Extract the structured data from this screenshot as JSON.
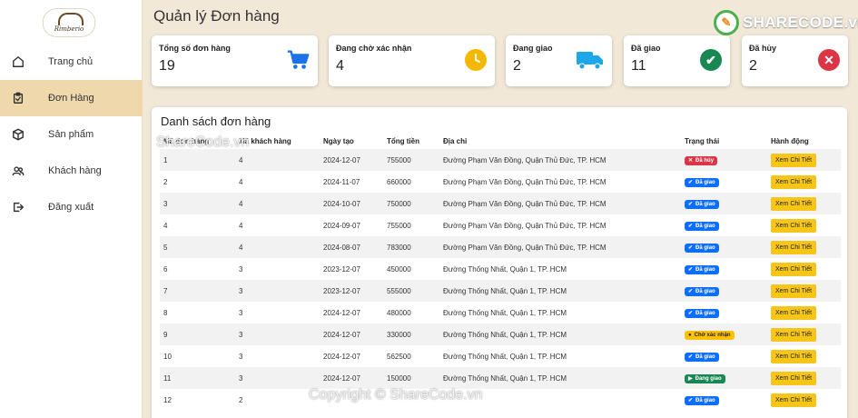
{
  "brand": {
    "logo_text": "Rimberio",
    "watermark_name": "SHARECODE",
    "watermark_tld": ".vn"
  },
  "watermark_top": "ShareCode.vn",
  "watermark_bottom": "Copyright © ShareCode.vn",
  "sidebar": {
    "items": [
      {
        "label": "Trang chủ",
        "icon": "home-icon"
      },
      {
        "label": "Đơn Hàng",
        "icon": "clipboard-icon",
        "active": true
      },
      {
        "label": "Sản phẩm",
        "icon": "box-icon"
      },
      {
        "label": "Khách hàng",
        "icon": "users-icon"
      },
      {
        "label": "Đăng xuất",
        "icon": "logout-icon"
      }
    ]
  },
  "page": {
    "title": "Quản lý Đơn hàng"
  },
  "stats": [
    {
      "label": "Tổng số đơn hàng",
      "value": "19",
      "icon": "cart-icon",
      "color": "#1a73e8"
    },
    {
      "label": "Đang chờ xác nhận",
      "value": "4",
      "icon": "clock-icon",
      "color": "#f5b800"
    },
    {
      "label": "Đang giao",
      "value": "2",
      "icon": "truck-icon",
      "color": "#1ea7e8"
    },
    {
      "label": "Đã giao",
      "value": "11",
      "icon": "check-circle-icon",
      "color": "#198754"
    },
    {
      "label": "Đã hủy",
      "value": "2",
      "icon": "x-circle-icon",
      "color": "#dc3545"
    }
  ],
  "orders": {
    "title": "Danh sách đơn hàng",
    "columns": [
      "Mã đơn hàng",
      "Mã khách hàng",
      "Ngày tạo",
      "Tổng tiền",
      "Địa chỉ",
      "Trạng thái",
      "Hành động"
    ],
    "action_label": "Xem Chi Tiết",
    "rows": [
      {
        "id": "1",
        "customer": "4",
        "date": "2024-12-07",
        "total": "755000",
        "address": "Đường Phạm Văn Đồng, Quận Thủ Đức, TP. HCM",
        "status": "Đã hủy",
        "status_type": "cancel"
      },
      {
        "id": "2",
        "customer": "4",
        "date": "2024-11-07",
        "total": "660000",
        "address": "Đường Phạm Văn Đồng, Quận Thủ Đức, TP. HCM",
        "status": "Đã giao",
        "status_type": "done"
      },
      {
        "id": "3",
        "customer": "4",
        "date": "2024-10-07",
        "total": "750000",
        "address": "Đường Phạm Văn Đồng, Quận Thủ Đức, TP. HCM",
        "status": "Đã giao",
        "status_type": "done"
      },
      {
        "id": "4",
        "customer": "4",
        "date": "2024-09-07",
        "total": "755000",
        "address": "Đường Phạm Văn Đồng, Quận Thủ Đức, TP. HCM",
        "status": "Đã giao",
        "status_type": "done"
      },
      {
        "id": "5",
        "customer": "4",
        "date": "2024-08-07",
        "total": "783000",
        "address": "Đường Phạm Văn Đồng, Quận Thủ Đức, TP. HCM",
        "status": "Đã giao",
        "status_type": "done"
      },
      {
        "id": "6",
        "customer": "3",
        "date": "2023-12-07",
        "total": "450000",
        "address": "Đường Thống Nhất, Quận 1, TP. HCM",
        "status": "Đã giao",
        "status_type": "done"
      },
      {
        "id": "7",
        "customer": "3",
        "date": "2023-12-07",
        "total": "555000",
        "address": "Đường Thống Nhất, Quận 1, TP. HCM",
        "status": "Đã giao",
        "status_type": "done"
      },
      {
        "id": "8",
        "customer": "3",
        "date": "2024-12-07",
        "total": "480000",
        "address": "Đường Thống Nhất, Quận 1, TP. HCM",
        "status": "Đã giao",
        "status_type": "done"
      },
      {
        "id": "9",
        "customer": "3",
        "date": "2024-12-07",
        "total": "330000",
        "address": "Đường Thống Nhất, Quận 1, TP. HCM",
        "status": "Chờ xác nhận",
        "status_type": "pending"
      },
      {
        "id": "10",
        "customer": "3",
        "date": "2024-12-07",
        "total": "562500",
        "address": "Đường Thống Nhất, Quận 1, TP. HCM",
        "status": "Đã giao",
        "status_type": "done"
      },
      {
        "id": "11",
        "customer": "3",
        "date": "2024-12-07",
        "total": "150000",
        "address": "Đường Thống Nhất, Quận 1, TP. HCM",
        "status": "Đang giao",
        "status_type": "ship"
      },
      {
        "id": "12",
        "customer": "2",
        "date": "",
        "total": "",
        "address": "",
        "status": "Đã giao",
        "status_type": "done"
      }
    ]
  }
}
